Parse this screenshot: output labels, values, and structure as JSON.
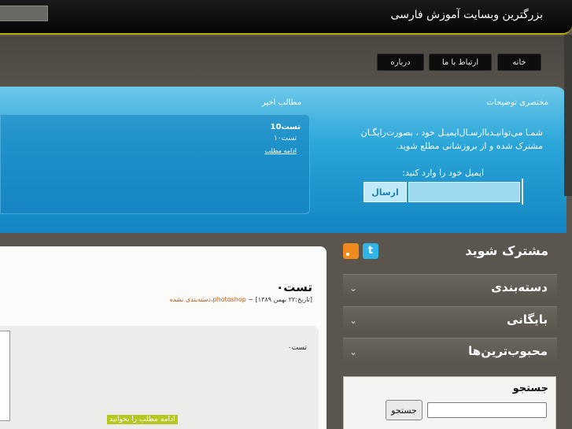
{
  "header": {
    "site_title": "بزرگترین وبسایت آموزش فارسی"
  },
  "nav": {
    "items": [
      "خانه",
      "ارتباط با ما",
      "درباره"
    ]
  },
  "banner": {
    "summary_heading": "مختصری توضیحات",
    "recent_heading": "مطالب اخیر",
    "recent_post": {
      "title": "تست10",
      "subtitle": "تست۱۰",
      "more": "ادامه مطلب"
    },
    "description": "شمـا می‌توانیـد‌با‌ارسـال‌ایمیـل خود ، بصورت‌رایگـان مشترک شده و از بروزشانی مطلع شوید.",
    "email_label": "ایمیل خود را وارد کنید:",
    "send_label": "ارسال"
  },
  "sidebar": {
    "subscribe_title": "مشترک شوید",
    "items": [
      "دسته‌بندی",
      "بایگانی",
      "محبوب‌ترین‌ها"
    ],
    "search_title": "جستجو",
    "search_button": "جستجو",
    "icons": [
      "rss-icon",
      "twitter-icon"
    ]
  },
  "content": {
    "post_title": "تست۰",
    "meta_date": "[تاریخ:۲۲ بهمن ۱۳۸۹]",
    "meta_sep": "~",
    "meta_category": "photoshop",
    "meta_tail": "،دسته‌بندی نشده",
    "body_text": "تست۰",
    "more_label": "ادامه مطلب را بخوانید"
  }
}
